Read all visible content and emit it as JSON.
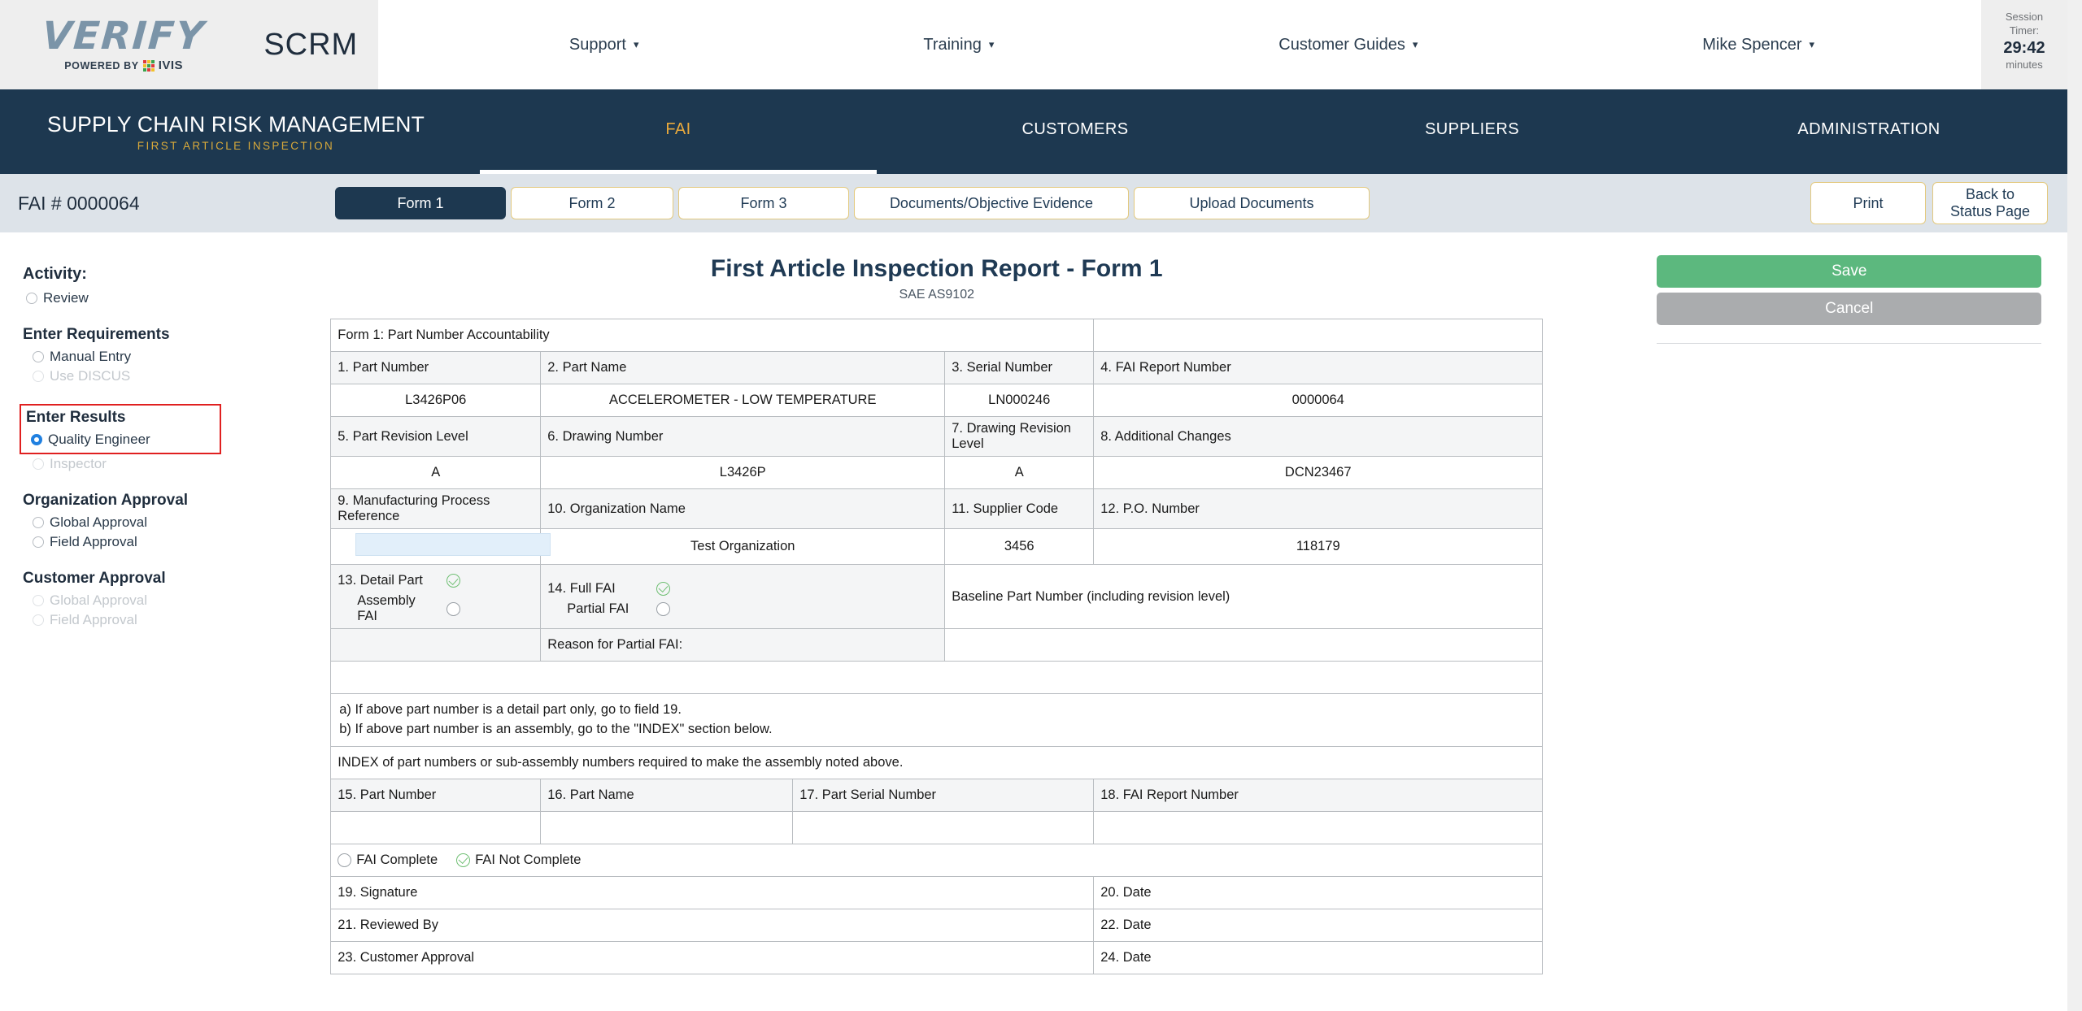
{
  "header": {
    "logo_word": "VERIFY",
    "powered_by": "POWERED BY",
    "ivis": "IVIS",
    "app_abbrev": "SCRM",
    "nav": [
      {
        "label": "Support",
        "icon": "chevron-down-icon"
      },
      {
        "label": "Training",
        "icon": "chevron-down-icon"
      },
      {
        "label": "Customer Guides",
        "icon": "chevron-down-icon"
      },
      {
        "label": "Mike Spencer",
        "icon": "chevron-down-icon"
      }
    ],
    "session": {
      "label_line1": "Session",
      "label_line2": "Timer:",
      "time": "29:42",
      "unit": "minutes"
    }
  },
  "navbar": {
    "title": "SUPPLY CHAIN RISK MANAGEMENT",
    "subtitle": "FIRST ARTICLE INSPECTION",
    "tabs": [
      {
        "label": "FAI",
        "active": true
      },
      {
        "label": "CUSTOMERS",
        "active": false
      },
      {
        "label": "SUPPLIERS",
        "active": false
      },
      {
        "label": "ADMINISTRATION",
        "active": false
      }
    ],
    "active_color": "#e9a93c",
    "background": "#1d3850"
  },
  "subbar": {
    "fai_number": "FAI # 0000064",
    "form_tabs": [
      {
        "label": "Form 1",
        "active": true
      },
      {
        "label": "Form 2",
        "active": false
      },
      {
        "label": "Form 3",
        "active": false
      },
      {
        "label": "Documents/Objective Evidence",
        "active": false
      },
      {
        "label": "Upload Documents",
        "active": false
      }
    ],
    "print_label": "Print",
    "back_label": "Back to Status Page"
  },
  "sidebar": {
    "activity_label": "Activity:",
    "review_option": {
      "label": "Review",
      "selected": false,
      "disabled": false
    },
    "groups": [
      {
        "heading": "Enter Requirements",
        "options": [
          {
            "label": "Manual Entry",
            "selected": false,
            "disabled": false
          },
          {
            "label": "Use DISCUS",
            "selected": false,
            "disabled": true
          }
        ],
        "highlighted": false
      },
      {
        "heading": "Enter Results",
        "options": [
          {
            "label": "Quality Engineer",
            "selected": true,
            "disabled": false
          },
          {
            "label": "Inspector",
            "selected": false,
            "disabled": true
          }
        ],
        "highlighted": true
      },
      {
        "heading": "Organization Approval",
        "options": [
          {
            "label": "Global Approval",
            "selected": false,
            "disabled": false
          },
          {
            "label": "Field Approval",
            "selected": false,
            "disabled": false
          }
        ],
        "highlighted": false
      },
      {
        "heading": "Customer Approval",
        "options": [
          {
            "label": "Global Approval",
            "selected": false,
            "disabled": true
          },
          {
            "label": "Field Approval",
            "selected": false,
            "disabled": true
          }
        ],
        "highlighted": false
      }
    ],
    "highlight_color": "#e02020"
  },
  "form": {
    "title": "First Article Inspection Report - Form 1",
    "subtitle": "SAE AS9102",
    "section_title": "Form 1: Part Number Accountability",
    "fields": {
      "f1_label": "1. Part Number",
      "f1_value": "L3426P06",
      "f2_label": "2. Part Name",
      "f2_value": "ACCELEROMETER - LOW TEMPERATURE",
      "f3_label": "3. Serial Number",
      "f3_value": "LN000246",
      "f4_label": "4. FAI Report Number",
      "f4_value": "0000064",
      "f5_label": "5. Part Revision Level",
      "f5_value": "A",
      "f6_label": "6. Drawing Number",
      "f6_value": "L3426P",
      "f7_label": "7. Drawing Revision Level",
      "f7_value": "A",
      "f8_label": "8. Additional Changes",
      "f8_value": "DCN23467",
      "f9_label": "9. Manufacturing Process Reference",
      "f9_value": "",
      "f10_label": "10. Organization Name",
      "f10_value": "Test Organization",
      "f11_label": "11. Supplier Code",
      "f11_value": "3456",
      "f12_label": "12. P.O. Number",
      "f12_value": "118179",
      "f13_label": "13. Detail Part",
      "f13_checked": true,
      "f13b_label": "Assembly FAI",
      "f13b_checked": false,
      "f14_label": "14. Full FAI",
      "f14_checked": true,
      "f14b_label": "Partial FAI",
      "f14b_checked": false,
      "baseline_label": "Baseline Part Number (including revision level)",
      "baseline_value": "",
      "reason_label": "Reason for Partial FAI:",
      "reason_value": ""
    },
    "notes": {
      "line_a": "a) If above part number is a detail part only, go to field 19.",
      "line_b": "b) If above part number is an assembly, go to the \"INDEX\" section below.",
      "index_note": "INDEX of part numbers or sub-assembly numbers required to make the assembly noted above."
    },
    "index_table": {
      "headers": [
        "15. Part Number",
        "16. Part Name",
        "17. Part Serial Number",
        "18. FAI Report Number"
      ],
      "rows": [
        [
          "",
          "",
          "",
          ""
        ]
      ]
    },
    "completion": {
      "complete_label": "FAI Complete",
      "complete_checked": false,
      "not_complete_label": "FAI Not Complete",
      "not_complete_checked": true
    },
    "signature_rows": [
      {
        "left": "19. Signature",
        "left_value": "",
        "right": "20. Date",
        "right_value": ""
      },
      {
        "left": "21. Reviewed By",
        "left_value": "",
        "right": "22. Date",
        "right_value": ""
      },
      {
        "left": "23. Customer Approval",
        "left_value": "",
        "right": "24. Date",
        "right_value": ""
      }
    ]
  },
  "actions": {
    "save_label": "Save",
    "cancel_label": "Cancel",
    "save_color": "#5cb87e",
    "cancel_color": "#aaacae"
  }
}
